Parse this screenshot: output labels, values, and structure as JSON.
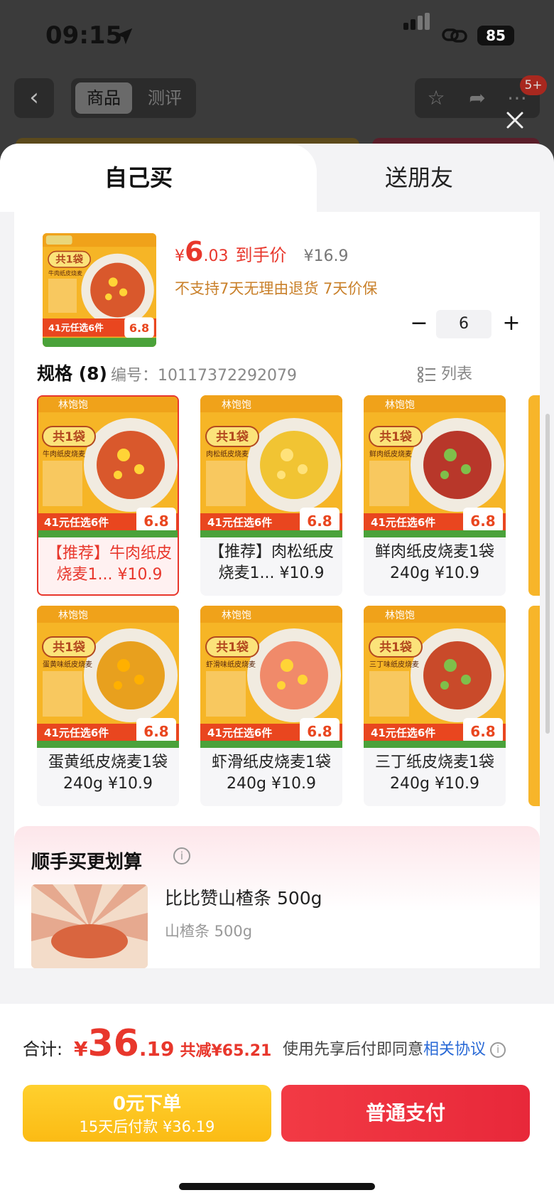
{
  "status": {
    "time": "09:15",
    "battery": "85"
  },
  "nav": {
    "tab_goods": "商品",
    "tab_review": "测评",
    "badge": "5+"
  },
  "sheet": {
    "tab_self": "自己买",
    "tab_gift": "送朋友",
    "product": {
      "currency": "¥",
      "price_int": "6",
      "price_dec": ".03",
      "price_label": "到手价",
      "orig_price": "¥16.9",
      "tags": "不支持7天无理由退货  7天价保",
      "qty_minus": "−",
      "qty": "6",
      "qty_plus": "+",
      "img_brand": "林饱饱",
      "img_title": "共1袋",
      "img_sub": "牛肉纸皮烧麦",
      "img_promo": "41元任选6件",
      "img_price": "6.8"
    },
    "spec": {
      "title": "规格 (8)",
      "code": "编号：10117372292079",
      "list_label": "列表",
      "items": [
        {
          "name": "【推荐】牛肉纸皮烧麦1... ¥10.9",
          "sub": "牛肉纸皮烧麦"
        },
        {
          "name": "【推荐】肉松纸皮烧麦1... ¥10.9",
          "sub": "肉松纸皮烧麦"
        },
        {
          "name": "鲜肉纸皮烧麦1袋 240g ¥10.9",
          "sub": "鲜肉纸皮烧麦"
        },
        {
          "name": "蛋黄纸皮烧麦1袋 240g ¥10.9",
          "sub": "蛋黄味纸皮烧麦"
        },
        {
          "name": "虾滑纸皮烧麦1袋 240g ¥10.9",
          "sub": "虾滑味纸皮烧麦"
        },
        {
          "name": "三丁纸皮烧麦1袋 240g ¥10.9",
          "sub": "三丁味纸皮烧麦"
        }
      ],
      "tile_brand": "林饱饱",
      "tile_title": "共1袋",
      "tile_promo": "41元任选6件",
      "tile_price": "6.8"
    },
    "upsell": {
      "title": "顺手买更划算",
      "name": "比比赞山楂条 500g",
      "sub": "山楂条 500g"
    }
  },
  "footer": {
    "total_label": "合计:",
    "total_cur": "¥",
    "total_int": "36",
    "total_dec": ".19",
    "saving": "共减¥65.21",
    "agree_text": "使用先享后付即同意",
    "agree_link": "相关协议",
    "btn_later_1": "0元下单",
    "btn_later_2": "15天后付款 ¥36.19",
    "btn_pay": "普通支付"
  }
}
